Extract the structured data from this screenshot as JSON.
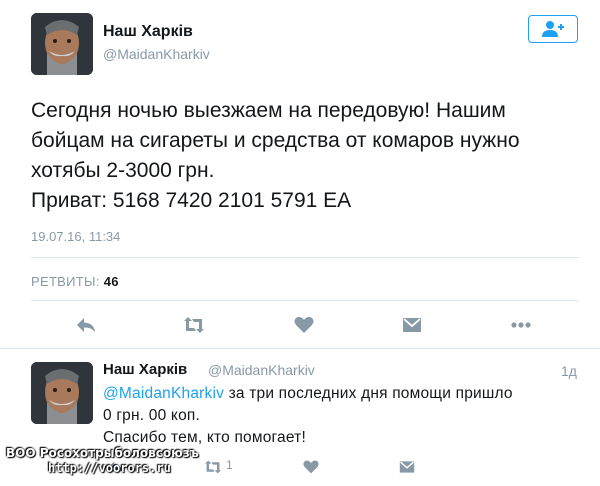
{
  "main_tweet": {
    "author_name": "Наш Харків",
    "author_handle": "@MaidanKharkiv",
    "follow_icon": "add-user-icon",
    "text_lines": [
      "Сегодня ночью выезжаем на передовую! Нашим",
      "бойцам на сигареты и средства от комаров нужно",
      "хотябы 2-3000 грн.",
      "Приват: 5168 7420 2101 5791 ЕА"
    ],
    "timestamp": "19.07.16, 11:34",
    "retweets_label": "РЕТВИТЫ:",
    "retweets_count": "46",
    "actions": [
      "reply-icon",
      "retweet-icon",
      "like-icon",
      "message-icon",
      "more-icon"
    ]
  },
  "reply_tweet": {
    "author_name": "Наш Харків",
    "author_handle": "@MaidanKharkiv",
    "time_ago": "1д",
    "mention": "@MaidanKharkiv",
    "text_line1_rest": " за три последних дня помощи пришло",
    "text_line2": "0 грн. 00 коп.",
    "text_line3": "Спасибо тем, кто помогает!",
    "retweet_count": "1"
  },
  "watermark": {
    "line1": "ВОО Росохотрыболовсоюзъ",
    "line2": "http://voorors.ru"
  },
  "colors": {
    "accent": "#1da1f2",
    "muted": "#8899a6",
    "text": "#14171a",
    "divider": "#e1e8ed"
  }
}
